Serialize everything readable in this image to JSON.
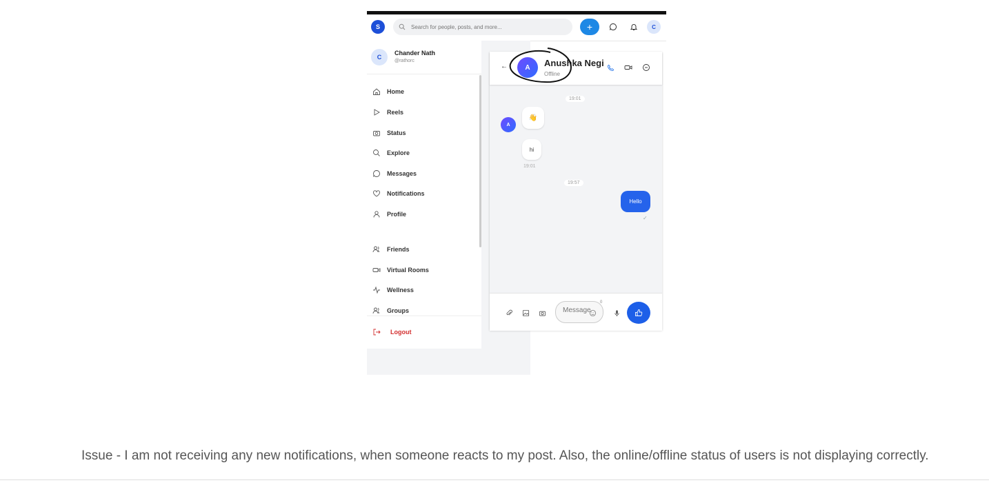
{
  "app": {
    "logo_letter": "S",
    "search_placeholder": "Search for people, posts, and more...",
    "plus_label": "+",
    "user_avatar_letter": "C",
    "accent_color": "#1d4fd8"
  },
  "sidebar": {
    "profile": {
      "avatar_letter": "C",
      "name": "Chander Nath",
      "handle": "@rathorc"
    },
    "items": [
      {
        "label": "Home",
        "icon": "home-icon"
      },
      {
        "label": "Reels",
        "icon": "play-icon"
      },
      {
        "label": "Status",
        "icon": "camera-icon"
      },
      {
        "label": "Explore",
        "icon": "search-icon"
      },
      {
        "label": "Messages",
        "icon": "message-icon"
      },
      {
        "label": "Notifications",
        "icon": "heart-icon"
      },
      {
        "label": "Profile",
        "icon": "user-icon"
      },
      {
        "label": "Friends",
        "icon": "users-icon"
      },
      {
        "label": "Virtual Rooms",
        "icon": "video-icon"
      },
      {
        "label": "Wellness",
        "icon": "activity-icon"
      },
      {
        "label": "Groups",
        "icon": "group-icon"
      }
    ],
    "logout_label": "Logout"
  },
  "chat": {
    "contact": {
      "avatar_letter": "A",
      "name": "Anushka Negi",
      "status": "Offline"
    },
    "messages": {
      "time_divider_1": "19:01",
      "incoming_emoji": "👋",
      "incoming_text": "hi",
      "incoming_time": "19:01",
      "time_divider_2": "19:57",
      "outgoing_text": "Hello",
      "outgoing_check": "✓",
      "incoming_avatar_letter": "A"
    },
    "composer": {
      "placeholder": "Message...",
      "char_count": "0"
    }
  },
  "issue_text": "Issue - I am not receiving any new notifications, when someone reacts to my post. Also, the online/offline status of users is not displaying correctly."
}
